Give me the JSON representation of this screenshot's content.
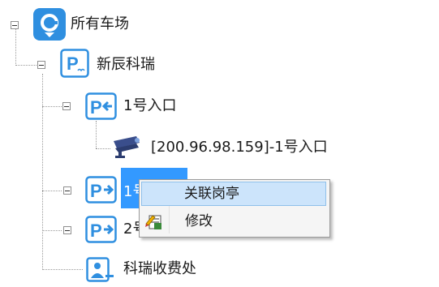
{
  "tree": {
    "root": {
      "label": "所有车场",
      "icon": "parking-app-icon",
      "expanded": true
    },
    "lot": {
      "label": "新辰科瑞",
      "icon": "parking-lot-icon",
      "expanded": true
    },
    "entry1": {
      "label": "1号入口",
      "icon": "entrance-icon",
      "expanded": true
    },
    "camera": {
      "label": "[200.96.98.159]-1号入口",
      "icon": "camera-icon"
    },
    "exit1": {
      "label": "1号",
      "icon": "exit-icon",
      "expanded": false
    },
    "exit2": {
      "label": "2号",
      "icon": "exit-icon",
      "expanded": false
    },
    "booth": {
      "label": "科瑞收费处",
      "icon": "toll-booth-icon"
    }
  },
  "context_menu": {
    "items": [
      {
        "label": "关联岗亭",
        "highlighted": true
      },
      {
        "label": "修改",
        "icon": "edit-icon"
      }
    ]
  },
  "colors": {
    "accent": "#2f8fe0",
    "selection": "#3399ff",
    "menu_hover": "#cce4fb"
  }
}
